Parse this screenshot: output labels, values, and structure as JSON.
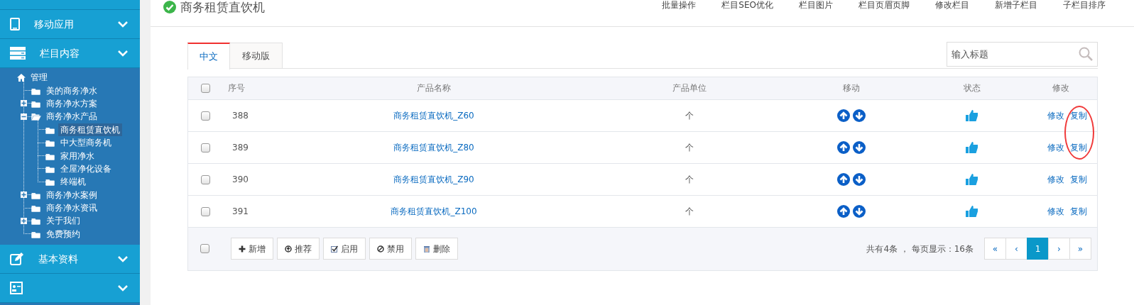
{
  "sidebar": {
    "menus_top": [
      {
        "label": "移动应用",
        "kind": "tablet"
      },
      {
        "label": "栏目内容",
        "kind": "list"
      }
    ],
    "tree": {
      "label": "管理",
      "children": [
        {
          "label": "美的商务净水",
          "selected": false
        },
        {
          "label": "商务净水方案",
          "selected": false,
          "expanded": false
        },
        {
          "label": "商务净水产品",
          "selected": false,
          "expanded": true,
          "children": [
            {
              "label": "商务租赁直饮机",
              "selected": true
            },
            {
              "label": "中大型商务机",
              "selected": false
            },
            {
              "label": "家用净水",
              "selected": false
            },
            {
              "label": "全屋净化设备",
              "selected": false
            },
            {
              "label": "终端机",
              "selected": false
            }
          ]
        },
        {
          "label": "商务净水案例",
          "selected": false,
          "expanded": false
        },
        {
          "label": "商务净水资讯",
          "selected": false
        },
        {
          "label": "关于我们",
          "selected": false,
          "expanded": false
        },
        {
          "label": "免费预约",
          "selected": false
        }
      ]
    },
    "menus_bottom": [
      {
        "label": "基本资料",
        "kind": "edit"
      },
      {
        "kind": "card"
      }
    ]
  },
  "header": {
    "title": "商务租赁直饮机",
    "actions": [
      "批量操作",
      "栏目SEO优化",
      "栏目图片",
      "栏目页眉页脚",
      "修改栏目",
      "新增子栏目",
      "子栏目排序"
    ]
  },
  "tabs": [
    {
      "label": "中文",
      "selected": true
    },
    {
      "label": "移动版",
      "selected": false
    }
  ],
  "search": {
    "placeholder": "输入标题"
  },
  "table": {
    "header_checked": false,
    "columns": [
      "序号",
      "产品名称",
      "产品单位",
      "移动",
      "状态",
      "修改"
    ],
    "rows": [
      {
        "checked": false,
        "number": "388",
        "name": "商务租赁直饮机_Z60",
        "unit": "个",
        "edit": "修改",
        "copy": "复制",
        "circled": true
      },
      {
        "checked": false,
        "number": "389",
        "name": "商务租赁直饮机_Z80",
        "unit": "个",
        "edit": "修改",
        "copy": "复制",
        "circled": true
      },
      {
        "checked": false,
        "number": "390",
        "name": "商务租赁直饮机_Z90",
        "unit": "个",
        "edit": "修改",
        "copy": "复制",
        "circled": false
      },
      {
        "checked": false,
        "number": "391",
        "name": "商务租赁直饮机_Z100",
        "unit": "个",
        "edit": "修改",
        "copy": "复制",
        "circled": false
      }
    ]
  },
  "footer": {
    "checked": false,
    "buttons": [
      {
        "label": "新增",
        "kind": "plus"
      },
      {
        "label": "推荐",
        "kind": "up"
      },
      {
        "label": "启用",
        "kind": "check"
      },
      {
        "label": "禁用",
        "kind": "ban"
      },
      {
        "label": "删除",
        "kind": "trash"
      }
    ],
    "summary": "共有4条 ， 每页显示：16条",
    "pages": [
      {
        "label": "«",
        "selected": false
      },
      {
        "label": "‹",
        "selected": false
      },
      {
        "label": "1",
        "selected": true
      },
      {
        "label": "›",
        "selected": false
      },
      {
        "label": "»",
        "selected": false
      }
    ]
  }
}
